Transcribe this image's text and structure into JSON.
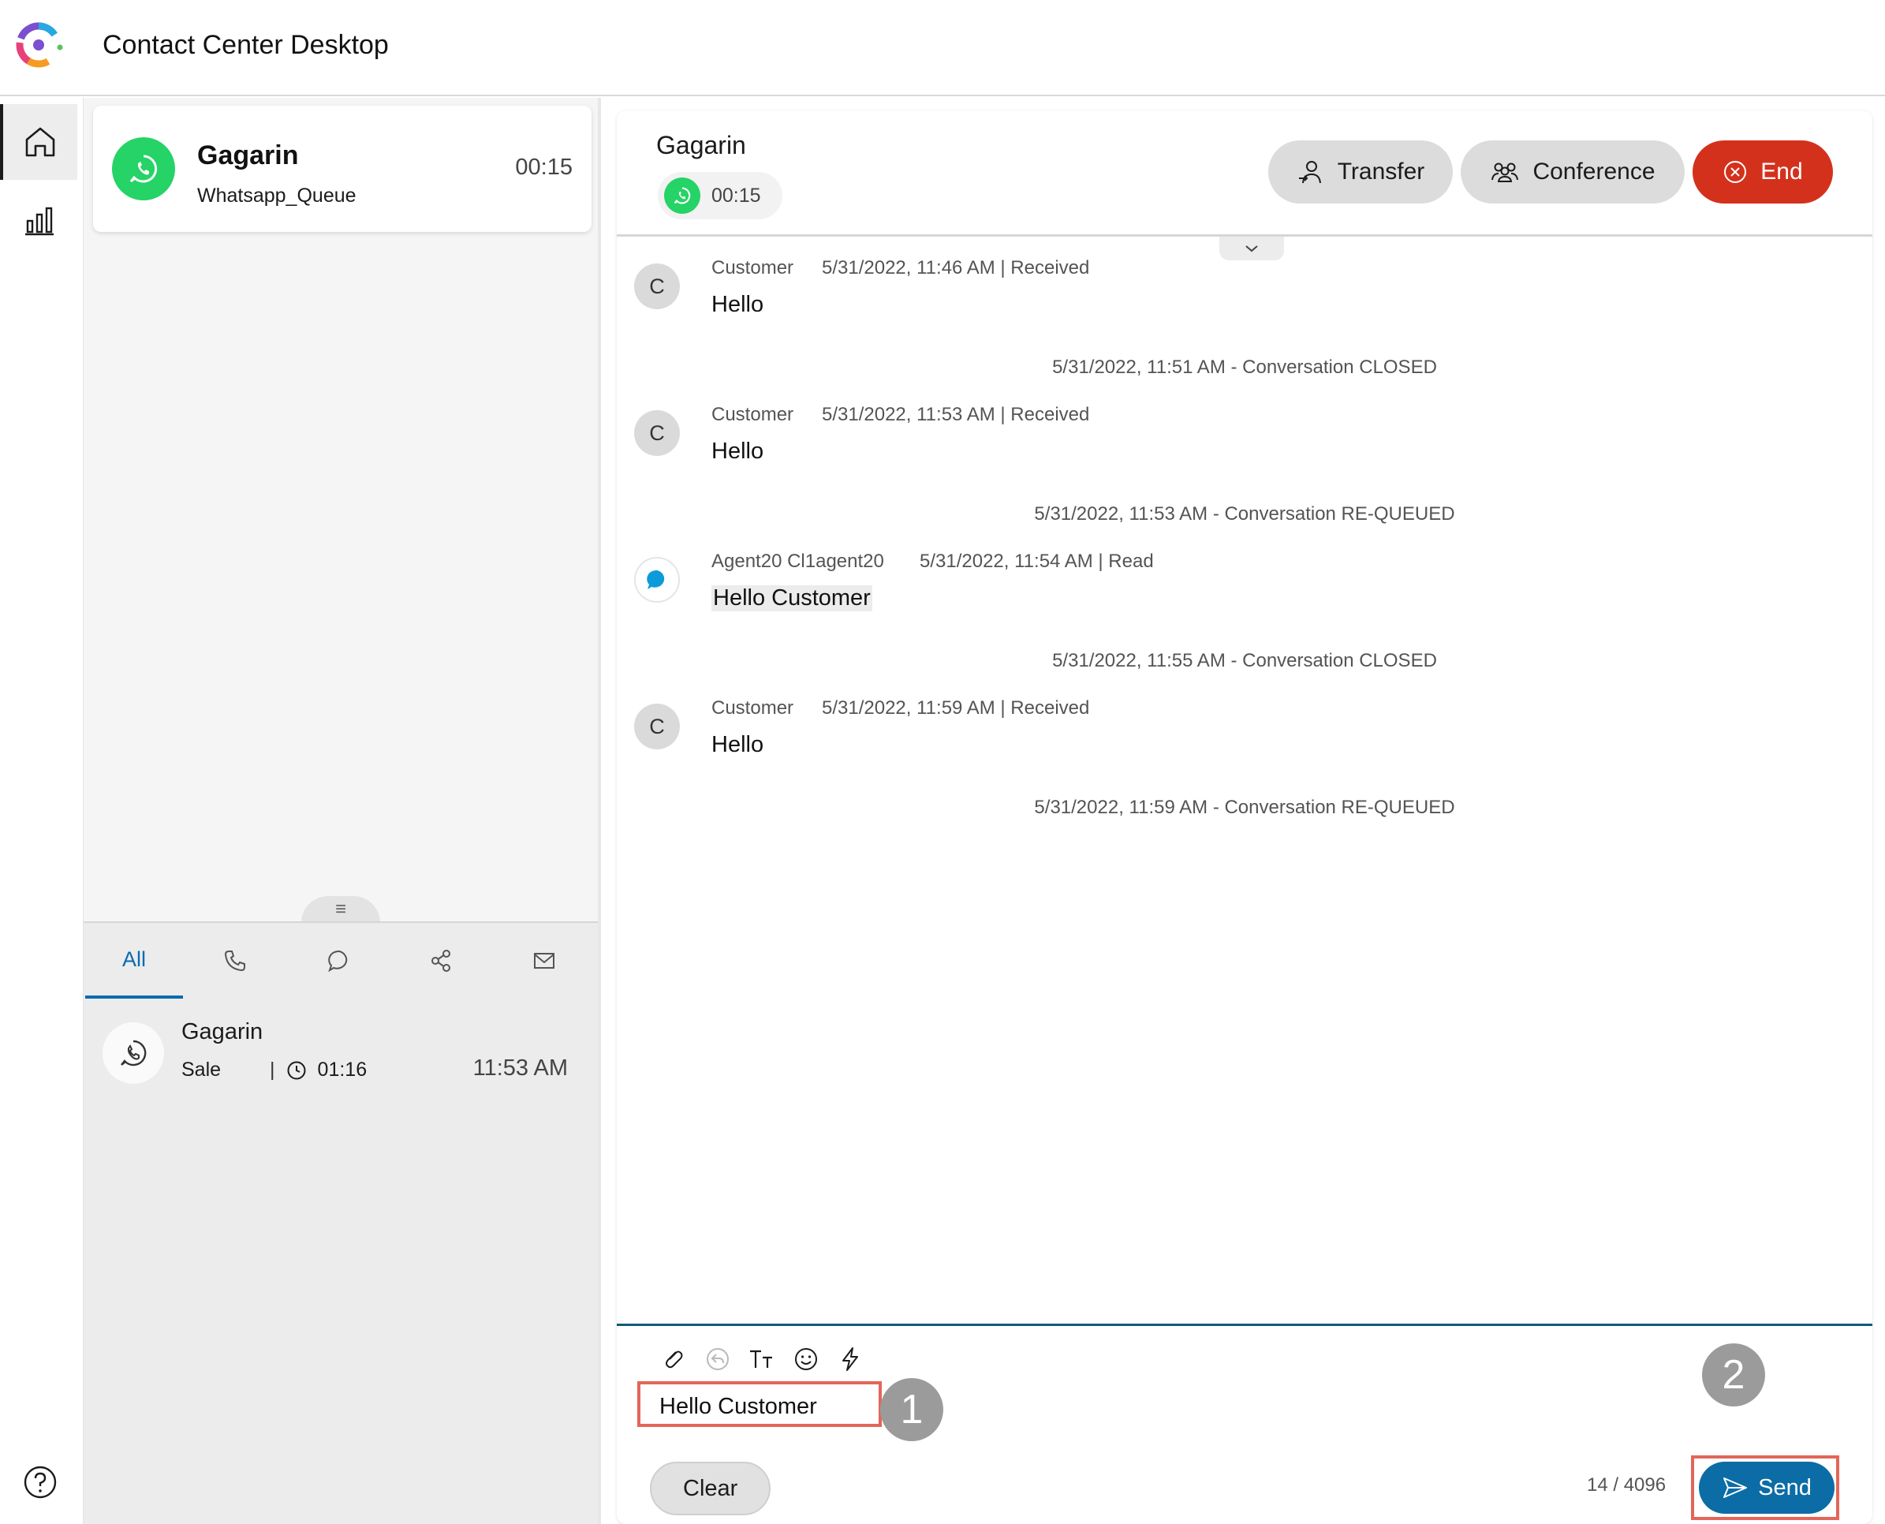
{
  "app": {
    "title": "Contact Center Desktop"
  },
  "active_task": {
    "name": "Gagarin",
    "queue": "Whatsapp_Queue",
    "duration": "00:15"
  },
  "history": {
    "tabs": [
      {
        "label": "All",
        "icon": "none"
      },
      {
        "icon": "phone-icon"
      },
      {
        "icon": "chat-icon"
      },
      {
        "icon": "social-icon"
      },
      {
        "icon": "email-icon"
      }
    ],
    "items": [
      {
        "name": "Gagarin",
        "queue": "Sale",
        "separator": "|",
        "duration": "01:16",
        "time": "11:53 AM"
      }
    ]
  },
  "conversation": {
    "contact_name": "Gagarin",
    "timer": "00:15",
    "buttons": {
      "transfer": "Transfer",
      "conference": "Conference",
      "end": "End"
    },
    "messages": [
      {
        "kind": "msg",
        "sender": "Customer",
        "stamp": "5/31/2022, 11:46 AM | Received",
        "text": "Hello",
        "avatar": "C"
      },
      {
        "kind": "event",
        "text": "5/31/2022, 11:51 AM - Conversation CLOSED"
      },
      {
        "kind": "msg",
        "sender": "Customer",
        "stamp": "5/31/2022, 11:53 AM | Received",
        "text": "Hello",
        "avatar": "C"
      },
      {
        "kind": "event",
        "text": "5/31/2022, 11:53 AM - Conversation RE-QUEUED"
      },
      {
        "kind": "msg",
        "sender": "Agent20 Cl1agent20",
        "stamp": "5/31/2022, 11:54 AM | Read",
        "text": "Hello Customer",
        "avatar": "agent"
      },
      {
        "kind": "event",
        "text": "5/31/2022, 11:55 AM - Conversation CLOSED"
      },
      {
        "kind": "msg",
        "sender": "Customer",
        "stamp": "5/31/2022, 11:59 AM | Received",
        "text": "Hello",
        "avatar": "C"
      },
      {
        "kind": "event",
        "text": "5/31/2022, 11:59 AM - Conversation RE-QUEUED"
      }
    ]
  },
  "composer": {
    "value": "Hello Customer",
    "clear_label": "Clear",
    "send_label": "Send",
    "char_count": "14 / 4096",
    "callouts": [
      "1",
      "2"
    ]
  },
  "colors": {
    "whatsapp": "#25d366",
    "end_button": "#d4311d",
    "send_button": "#0c6ca6",
    "active_tab": "#0a6bb0",
    "callout_frame": "#e2665a"
  }
}
